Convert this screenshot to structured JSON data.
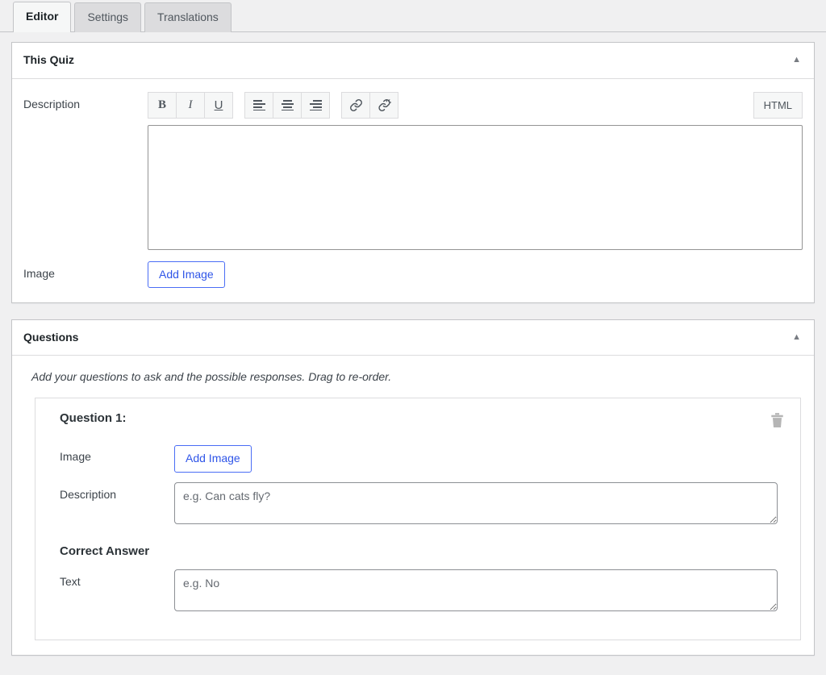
{
  "tabs": [
    {
      "label": "Editor",
      "active": true
    },
    {
      "label": "Settings",
      "active": false
    },
    {
      "label": "Translations",
      "active": false
    }
  ],
  "quiz_panel": {
    "title": "This Quiz",
    "toggle_icon": "chevron-up-icon",
    "toggle_glyph": "▲",
    "description_label": "Description",
    "description_value": "",
    "image_label": "Image",
    "add_image_label": "Add Image",
    "toolbar": {
      "bold_label": "B",
      "italic_label": "I",
      "underline_label": "U",
      "align_left_icon": "align-left-icon",
      "align_center_icon": "align-center-icon",
      "align_right_icon": "align-right-icon",
      "link_icon": "link-icon",
      "unlink_icon": "unlink-icon",
      "html_label": "HTML"
    }
  },
  "questions_panel": {
    "title": "Questions",
    "toggle_icon": "chevron-up-icon",
    "toggle_glyph": "▲",
    "intro": "Add your questions to ask and the possible responses. Drag to re-order.",
    "question": {
      "title": "Question 1:",
      "delete_icon": "trash-icon",
      "image_label": "Image",
      "add_image_label": "Add Image",
      "description_label": "Description",
      "description_placeholder": "e.g. Can cats fly?",
      "description_value": "",
      "correct_answer_title": "Correct Answer",
      "text_label": "Text",
      "text_placeholder": "e.g. No",
      "text_value": ""
    }
  },
  "colors": {
    "page_background": "#f0f0f1",
    "panel_background": "#ffffff",
    "panel_border": "#c3c4c7",
    "accent_blue": "#2f55e8",
    "text_primary": "#1d2327",
    "text_secondary": "#3c434a",
    "placeholder": "#646970"
  }
}
